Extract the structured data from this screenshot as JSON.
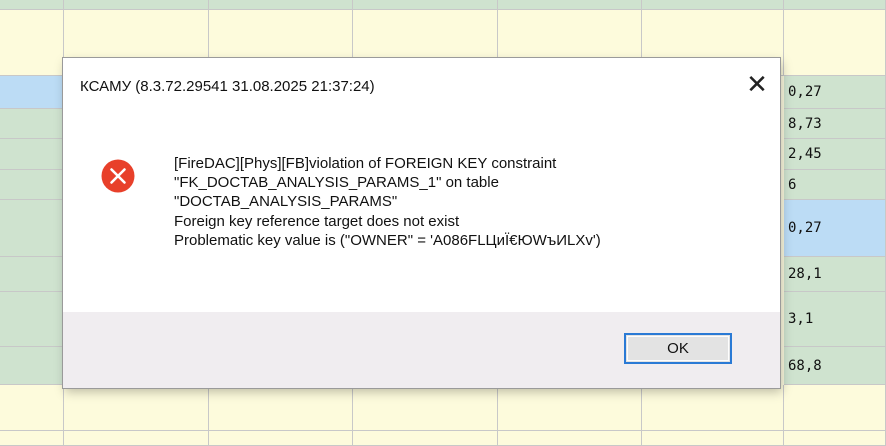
{
  "dialog": {
    "title": "КСАМУ (8.3.72.29541 31.08.2025 21:37:24)",
    "close_symbol": "✕",
    "error_icon": "error-x-icon",
    "message_lines": [
      "[FireDAC][Phys][FB]violation of FOREIGN KEY constraint",
      "\"FK_DOCTAB_ANALYSIS_PARAMS_1\" on table",
      "\"DOCTAB_ANALYSIS_PARAMS\"",
      "Foreign key reference target does not exist",
      "Problematic key value is (\"OWNER\" = 'A086FLЦиЇ€ЮWъИLXv')"
    ],
    "ok_label": "OK"
  },
  "grid": {
    "values": [
      "0,27",
      "8,73",
      "2,45",
      "6",
      "0,27",
      "28,1",
      "3,1",
      "68,8"
    ]
  },
  "colors": {
    "error_red": "#e8402a",
    "ok_border": "#2a7ad5",
    "row_green": "#cfe3cf",
    "row_blue": "#bcdcf5",
    "row_yellow": "#fdfbdc"
  }
}
